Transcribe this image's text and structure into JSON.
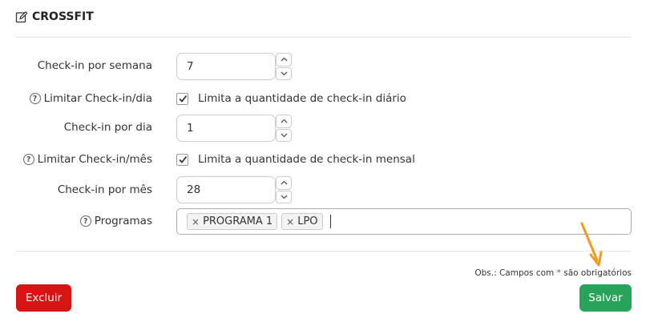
{
  "section": {
    "title": "CROSSFIT",
    "icon": "edit-icon"
  },
  "fields": {
    "checkin_semana": {
      "label": "Check-in por semana",
      "value": "7"
    },
    "limitar_dia": {
      "label": "Limitar Check-in/dia",
      "checkbox_label": "Limita a quantidade de check-in diário",
      "checked": true
    },
    "checkin_dia": {
      "label": "Check-in por dia",
      "value": "1"
    },
    "limitar_mes": {
      "label": "Limitar Check-in/mês",
      "checkbox_label": "Limita a quantidade de check-in mensal",
      "checked": true
    },
    "checkin_mes": {
      "label": "Check-in por mês",
      "value": "28"
    },
    "programas": {
      "label": "Programas",
      "tags": [
        "PROGRAMA 1",
        "LPO"
      ]
    }
  },
  "help_icon": "?",
  "tag_remove": "×",
  "note": {
    "prefix": "Obs.: Campos com ",
    "required_mark": "*",
    "suffix": " são obrigatórios"
  },
  "buttons": {
    "delete": "Excluir",
    "save": "Salvar"
  },
  "colors": {
    "delete": "#d71414",
    "save": "#28a45a",
    "arrow": "#f39a1e",
    "required": "#d93025"
  }
}
